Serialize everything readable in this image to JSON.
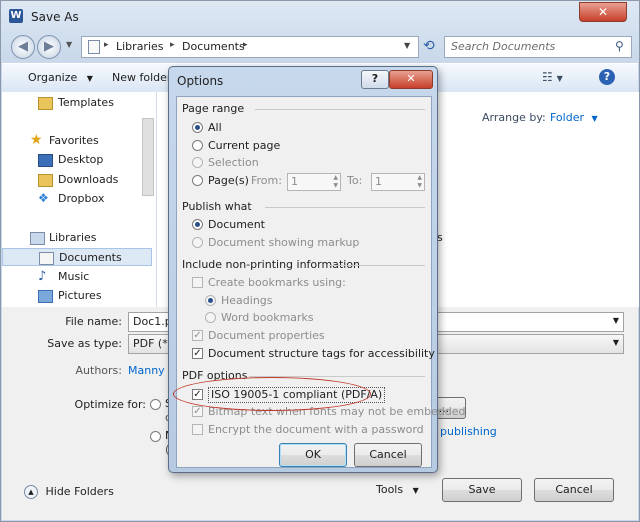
{
  "window": {
    "app_icon": "W",
    "title": "Save As",
    "close": "✕"
  },
  "nav": {
    "path": [
      "Libraries",
      "Documents"
    ],
    "search_placeholder": "Search Documents"
  },
  "toolbar": {
    "organize": "Organize",
    "new_folder": "New folder"
  },
  "nav_pane": {
    "items": [
      {
        "label": "Templates"
      },
      {
        "label": "Favorites"
      },
      {
        "label": "Desktop"
      },
      {
        "label": "Downloads"
      },
      {
        "label": "Dropbox"
      },
      {
        "label": "Libraries"
      },
      {
        "label": "Documents"
      },
      {
        "label": "Music"
      },
      {
        "label": "Pictures"
      }
    ]
  },
  "content": {
    "arrange_by_label": "Arrange by:",
    "arrange_value": "Folder",
    "fragment": "s"
  },
  "form": {
    "file_name_label": "File name:",
    "file_name_value": "Doc1.p",
    "save_as_type_label": "Save as type:",
    "save_as_type_value": "PDF (*.p",
    "authors_label": "Authors:",
    "authors_value": "Manny",
    "optimize_label": "Optimize for:",
    "opt_frag1": "S",
    "opt_frag2": "c",
    "opt_frag3": "M",
    "opt_frag4": "(",
    "options_btn_frag": "ns...",
    "publishing_frag": "r publishing"
  },
  "footer": {
    "hide_folders": "Hide Folders",
    "tools": "Tools",
    "save": "Save",
    "cancel": "Cancel"
  },
  "options_dialog": {
    "title": "Options",
    "help": "?",
    "close": "✕",
    "page_range": {
      "heading": "Page range",
      "all": "All",
      "current_page": "Current page",
      "selection": "Selection",
      "pages": "Page(s)",
      "from_label": "From:",
      "from_value": "1",
      "to_label": "To:",
      "to_value": "1"
    },
    "publish_what": {
      "heading": "Publish what",
      "document": "Document",
      "document_markup": "Document showing markup"
    },
    "non_printing": {
      "heading": "Include non-printing information",
      "create_bookmarks": "Create bookmarks using:",
      "headings": "Headings",
      "word_bookmarks": "Word bookmarks",
      "doc_properties": "Document properties",
      "structure_tags": "Document structure tags for accessibility"
    },
    "pdf_options": {
      "heading": "PDF options",
      "iso": "ISO 19005-1 compliant (PDF/A)",
      "bitmap_text": "Bitmap text when fonts may not be embedded",
      "encrypt": "Encrypt the document with a password"
    },
    "ok": "OK",
    "cancel": "Cancel"
  },
  "colors": {
    "annotation": "#c0392b",
    "link": "#0066cc"
  }
}
